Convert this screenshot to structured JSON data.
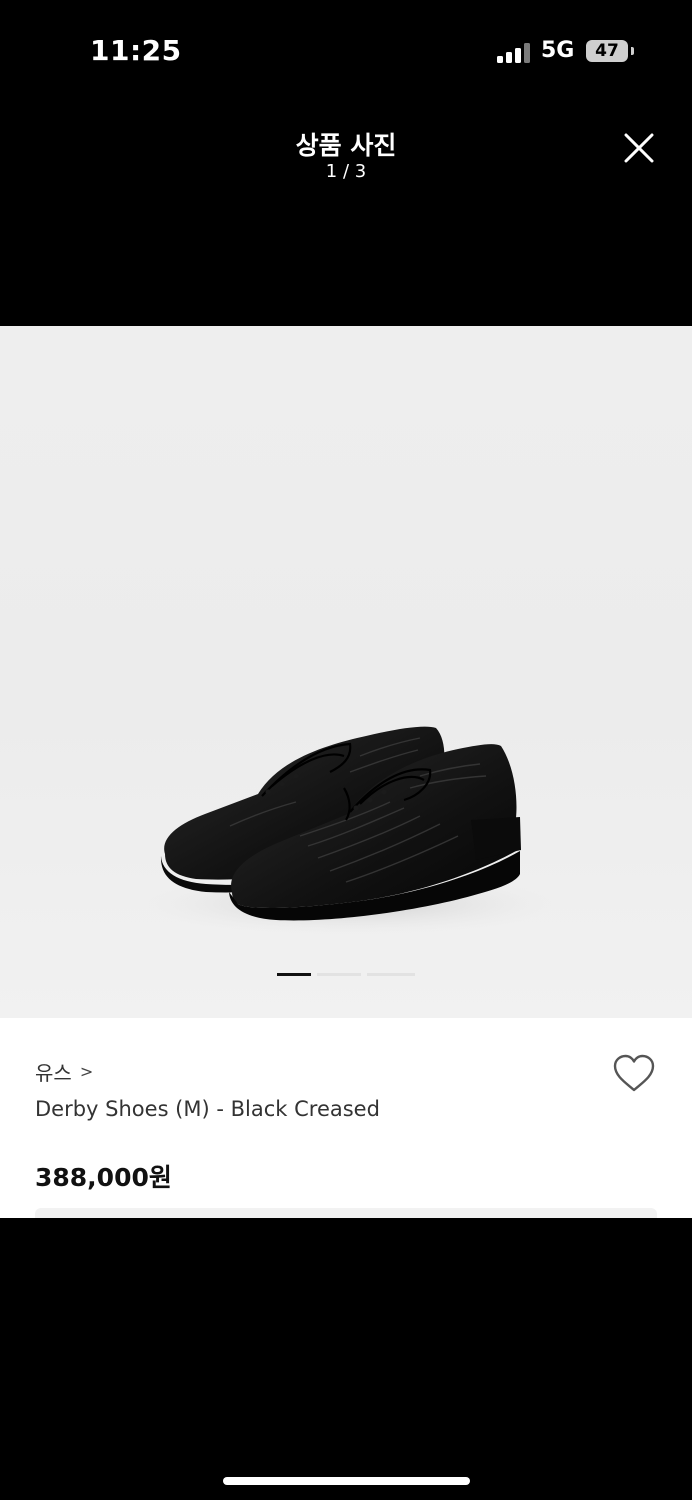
{
  "status_bar": {
    "time": "11:25",
    "network": "5G",
    "battery": "47"
  },
  "viewer": {
    "title": "상품 사진",
    "counter": "1 / 3",
    "close_icon": "close-icon"
  },
  "gallery": {
    "slide_index": 1,
    "slide_count": 3
  },
  "product": {
    "brand": "유스",
    "name": "Derby Shoes (M) - Black Creased",
    "price": "388,000원",
    "favorite_icon": "heart-outline-icon"
  }
}
